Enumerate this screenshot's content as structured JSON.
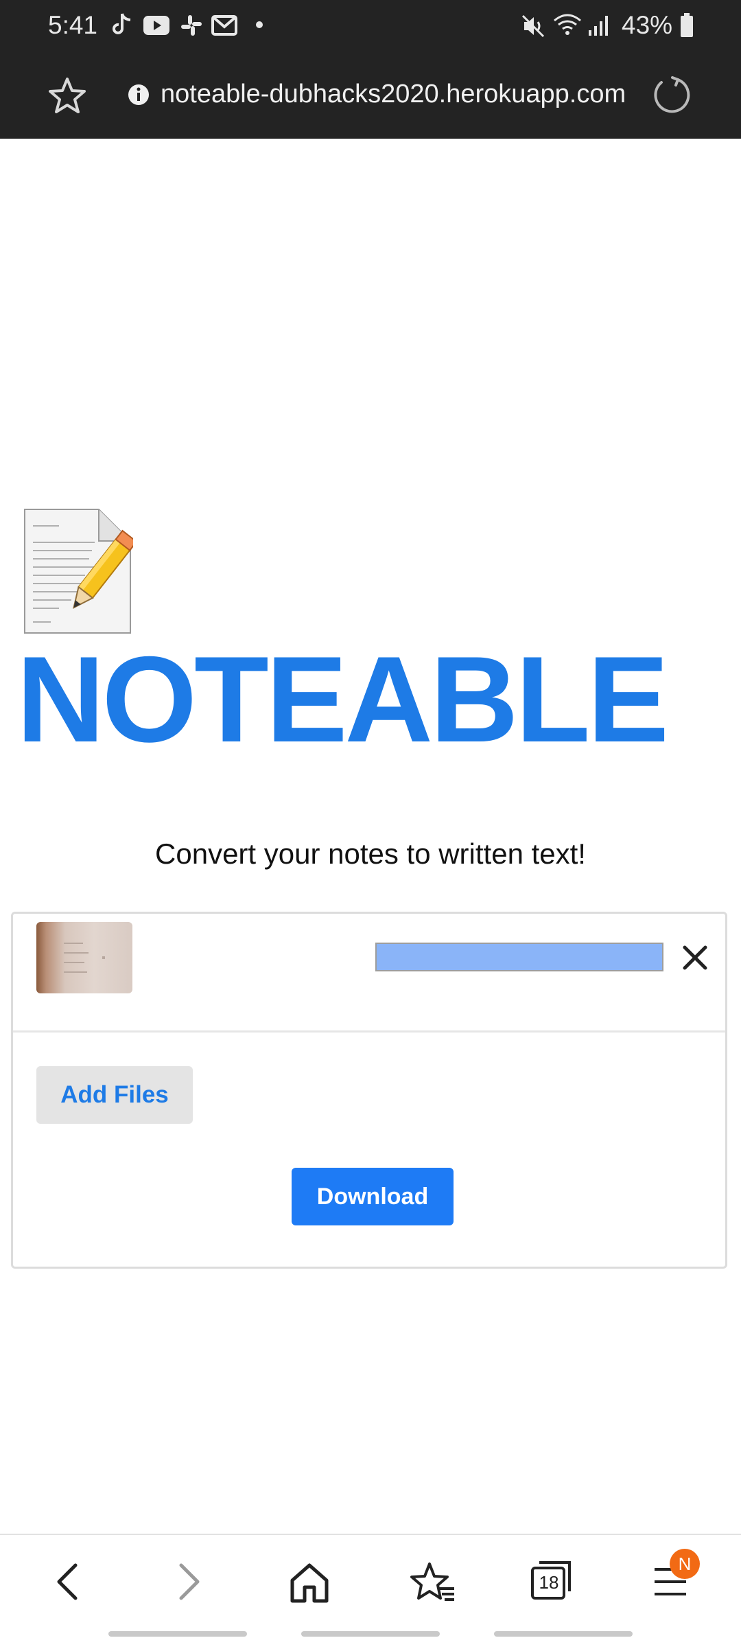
{
  "status_bar": {
    "time": "5:41",
    "battery_percent": "43%",
    "notification_icons": [
      "tiktok-icon",
      "youtube-icon",
      "slack-icon",
      "gmail-icon",
      "dot-icon"
    ],
    "system_icons": [
      "mute-icon",
      "wifi-icon",
      "signal-icon",
      "battery-icon"
    ]
  },
  "url_bar": {
    "url": "noteable-dubhacks2020.herokuapp.com"
  },
  "page": {
    "brand": "NOTEABLE",
    "tagline": "Convert your notes to written text!"
  },
  "uploader": {
    "file": {
      "progress": 1.0
    },
    "add_files_label": "Add Files",
    "download_label": "Download"
  },
  "bottom_bar": {
    "tabs_count": "18",
    "menu_badge": "N"
  },
  "colors": {
    "brand_blue": "#1e7be6",
    "download_blue": "#1e7bf5",
    "progress_fill": "#8ab4f8",
    "badge_orange": "#f26a14",
    "chrome_dark": "#232323"
  }
}
